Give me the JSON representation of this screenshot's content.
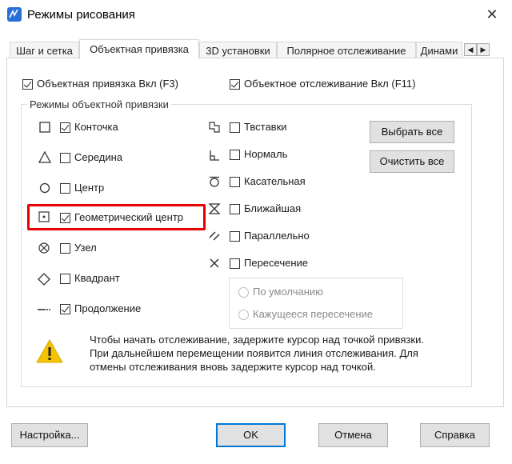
{
  "window": {
    "title": "Режимы рисования",
    "close_icon": "close-icon"
  },
  "tabs": [
    {
      "label": "Шаг и сетка"
    },
    {
      "label": "Объектная привязка",
      "active": true
    },
    {
      "label": "3D установки"
    },
    {
      "label": "Полярное отслеживание"
    },
    {
      "label": "Динами"
    }
  ],
  "top_options": {
    "snap_on": {
      "label": "Объектная привязка Вкл (F3)",
      "checked": true
    },
    "tracking_on": {
      "label": "Объектное отслеживание Вкл (F11)",
      "checked": true
    }
  },
  "group_title": "Режимы объектной привязки",
  "left_modes": [
    {
      "label": "Конточка",
      "checked": true,
      "icon": "square-endpoint-icon"
    },
    {
      "label": "Середина",
      "checked": false,
      "icon": "triangle-midpoint-icon"
    },
    {
      "label": "Центр",
      "checked": false,
      "icon": "circle-center-icon"
    },
    {
      "label": "Геометрический центр",
      "checked": true,
      "icon": "geometric-center-icon"
    },
    {
      "label": "Узел",
      "checked": false,
      "icon": "node-icon"
    },
    {
      "label": "Квадрант",
      "checked": false,
      "icon": "diamond-quadrant-icon"
    },
    {
      "label": "Продолжение",
      "checked": true,
      "icon": "extension-icon"
    }
  ],
  "right_modes": [
    {
      "label": "Твставки",
      "checked": false,
      "icon": "insertion-icon"
    },
    {
      "label": "Нормаль",
      "checked": false,
      "icon": "perpendicular-icon"
    },
    {
      "label": "Касательная",
      "checked": false,
      "icon": "tangent-icon"
    },
    {
      "label": "Ближайшая",
      "checked": false,
      "icon": "nearest-icon"
    },
    {
      "label": "Параллельно",
      "checked": false,
      "icon": "parallel-icon"
    },
    {
      "label": "Пересечение",
      "checked": false,
      "icon": "intersection-icon"
    }
  ],
  "intersection_options": {
    "default": "По умолчанию",
    "apparent": "Кажущееся пересечение"
  },
  "buttons": {
    "select_all": "Выбрать все",
    "clear_all": "Очистить все",
    "settings": "Настройка...",
    "ok": "OK",
    "cancel": "Отмена",
    "help": "Справка"
  },
  "hint": {
    "icon": "warning-icon",
    "line1": "Чтобы начать отслеживание, задержите курсор над точкой привязки.",
    "line2": "При дальнейшем перемещении появится линия отслеживания. Для",
    "line3": "отмены отслеживания вновь задержите курсор над точкой."
  },
  "colors": {
    "highlight": "#e60000",
    "accent": "#0078d7",
    "warning": "#f5c400"
  }
}
